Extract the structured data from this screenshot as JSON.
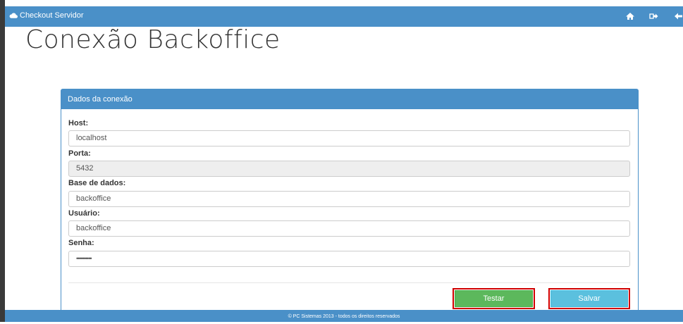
{
  "app": {
    "brand": "Checkout Servidor"
  },
  "topbar": {
    "icons": [
      "home-icon",
      "sign-out-icon",
      "back-arrow-icon"
    ]
  },
  "page": {
    "title": "Conexão Backoffice"
  },
  "panel": {
    "heading": "Dados da conexão",
    "fields": [
      {
        "label": "Host:",
        "value": "localhost",
        "disabled": false
      },
      {
        "label": "Porta:",
        "value": "5432",
        "disabled": true
      },
      {
        "label": "Base de dados:",
        "value": "backoffice",
        "disabled": false
      },
      {
        "label": "Usuário:",
        "value": "backoffice",
        "disabled": false
      },
      {
        "label": "Senha:",
        "value": "••••••••••",
        "disabled": false
      }
    ],
    "buttons": {
      "test_label": "Testar",
      "save_label": "Salvar"
    }
  },
  "footer": {
    "text": "© PC Sistemas 2013 - todos os direitos reservados"
  },
  "colors": {
    "accent": "#4a90c8",
    "success": "#5cb85c",
    "info": "#5bc0de",
    "highlight": "#d00000"
  }
}
